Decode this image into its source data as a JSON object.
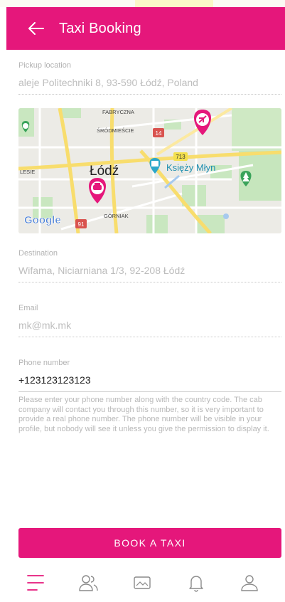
{
  "colors": {
    "brand": "#e5177b",
    "label": "#b3b3b3",
    "inactive_icon": "#8a8a8a"
  },
  "app_bar": {
    "title": "Taxi Booking",
    "back_icon": "arrow-left-icon"
  },
  "pickup": {
    "label": "Pickup location",
    "value": "aleje Politechniki 8, 93-590 Łódź, Poland"
  },
  "map": {
    "city": "Łódź",
    "labels": {
      "fabryczna": "FABRYCZNA",
      "srodmiescie": "ŚRÓDMIEŚCIE",
      "lesie": "LESIE",
      "gorniak": "GÓRNIAK",
      "ksiezy": "Księży Młyn",
      "logo": "Google"
    },
    "road_badges": [
      "14",
      "713",
      "91"
    ],
    "markers": [
      "taxi-pin-icon",
      "destination-pin-icon",
      "castle-icon",
      "tree-icon",
      "paw-icon"
    ]
  },
  "destination": {
    "label": "Destination",
    "value": "Wifama, Niciarniana 1/3, 92-208 Łódź"
  },
  "email": {
    "label": "Email",
    "value": "mk@mk.mk"
  },
  "phone": {
    "label": "Phone number",
    "value": "+123123123123",
    "help": "Please enter your phone number along with the country code. The cab company will contact you through this number, so it is very important to provide a real phone number. The phone number will be visible in your profile, but nobody will see it unless you give the permission to display it."
  },
  "book_button": {
    "label": "BOOK A TAXI"
  },
  "bottom_nav": [
    {
      "icon": "menu-icon",
      "active": true
    },
    {
      "icon": "people-icon",
      "active": false
    },
    {
      "icon": "image-icon",
      "active": false
    },
    {
      "icon": "bell-icon",
      "active": false
    },
    {
      "icon": "profile-icon",
      "active": false
    }
  ]
}
